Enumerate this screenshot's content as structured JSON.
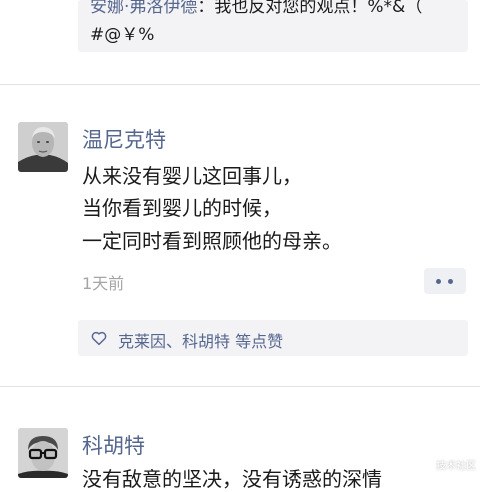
{
  "previous_comment": {
    "author": "安娜·弗洛伊德",
    "separator": "：",
    "text_line1": "我也反对您的观点！%*&（",
    "text_line2": "#@￥%"
  },
  "post1": {
    "author": "温尼克特",
    "lines": [
      "从来没有婴儿这回事儿，",
      "当你看到婴儿的时候，",
      "一定同时看到照顾他的母亲。"
    ],
    "timestamp": "1天前",
    "likes": {
      "icon": "heart-icon",
      "names": "克莱因、科胡特",
      "suffix": " 等点赞"
    }
  },
  "post2": {
    "author": "科胡特",
    "line1": "没有敌意的坚决，没有诱惑的深情"
  },
  "watermark": "技术社区",
  "colors": {
    "name_link": "#56678f",
    "comment_bg": "#f3f3f5",
    "timestamp": "#a5a5a5"
  }
}
